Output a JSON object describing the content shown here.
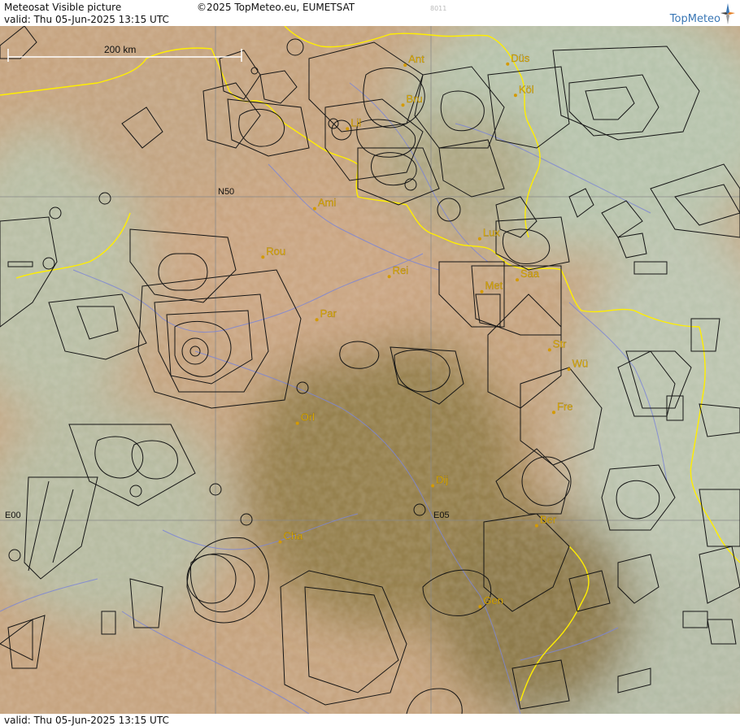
{
  "header": {
    "title": "Meteosat Visible picture",
    "valid": "valid:  Thu  05-Jun-2025  13:15 UTC",
    "copyright": "©2025 TopMeteo.eu, EUMETSAT",
    "code": "8011",
    "brand": "TopMeteo",
    "logo_icon": "compass-star-icon"
  },
  "footer": {
    "valid": "valid:  Thu  05-Jun-2025  13:15 UTC"
  },
  "map": {
    "scale_label": "200 km",
    "grid_labels": {
      "n50": "N50",
      "e00": "E00",
      "e05": "E05"
    },
    "cities": [
      {
        "name": "Ant",
        "lon": 4.4,
        "lat": 51.22
      },
      {
        "name": "Düs",
        "lon": 6.78,
        "lat": 51.23
      },
      {
        "name": "Köl",
        "lon": 6.96,
        "lat": 50.94
      },
      {
        "name": "Bru",
        "lon": 4.35,
        "lat": 50.85
      },
      {
        "name": "Lil",
        "lon": 3.06,
        "lat": 50.63
      },
      {
        "name": "Ami",
        "lon": 2.3,
        "lat": 49.89
      },
      {
        "name": "Lux",
        "lon": 6.13,
        "lat": 49.61
      },
      {
        "name": "Rou",
        "lon": 1.1,
        "lat": 49.44
      },
      {
        "name": "Rei",
        "lon": 4.03,
        "lat": 49.26
      },
      {
        "name": "Saa",
        "lon": 7.0,
        "lat": 49.23
      },
      {
        "name": "Met",
        "lon": 6.18,
        "lat": 49.12
      },
      {
        "name": "Par",
        "lon": 2.35,
        "lat": 48.86
      },
      {
        "name": "Str",
        "lon": 7.75,
        "lat": 48.58
      },
      {
        "name": "Wü",
        "lon": 8.2,
        "lat": 48.4
      },
      {
        "name": "Orl",
        "lon": 1.9,
        "lat": 47.9
      },
      {
        "name": "Fre",
        "lon": 7.85,
        "lat": 48.0
      },
      {
        "name": "Dij",
        "lon": 5.04,
        "lat": 47.32
      },
      {
        "name": "Ber",
        "lon": 7.45,
        "lat": 46.95
      },
      {
        "name": "Cha",
        "lon": 1.5,
        "lat": 46.8
      },
      {
        "name": "Gen",
        "lon": 6.14,
        "lat": 46.2
      }
    ],
    "colors": {
      "city_label": "#e8b400",
      "city_dot": "#d49a00",
      "border": "#ffee00",
      "river": "#7d86d6",
      "airspace": "#151515",
      "grid": "#888888"
    }
  }
}
